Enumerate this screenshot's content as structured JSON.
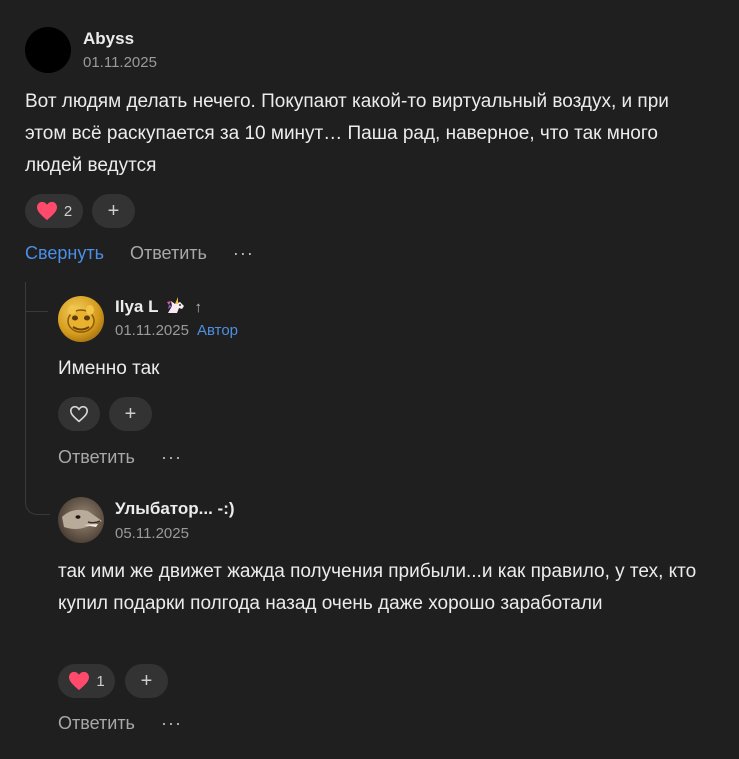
{
  "comments": [
    {
      "author": "Abyss",
      "date": "01.11.2025",
      "text": "Вот людям делать нечего. Покупают какой-то виртуальный воздух, и при этом всё раскупается за 10 минут… Паша рад, наверное, что так много людей ведутся",
      "likes": "2",
      "add": "+",
      "collapse_label": "Свернуть",
      "reply_label": "Ответить",
      "more": "···"
    },
    {
      "author": "Ilya L",
      "date": "01.11.2025",
      "badge": "Автор",
      "author_arrow": "↑",
      "text": "Именно так",
      "add": "+",
      "reply_label": "Ответить",
      "more": "···"
    },
    {
      "author": "Улыбатор... -:)",
      "date": "05.11.2025",
      "text": "так ими же движет жажда получения прибыли...и как правило, у тех, кто купил подарки полгода назад очень даже хорошо заработали",
      "likes": "1",
      "add": "+",
      "reply_label": "Ответить",
      "more": "···"
    }
  ],
  "icons": {
    "heart_filled": "heart-icon",
    "heart_outline": "heart-outline-icon",
    "unicorn": "unicorn-icon",
    "more": "more-icon"
  },
  "colors": {
    "background": "#1f1f1f",
    "accent": "#4a8fe8",
    "heart": "#ff4a6b"
  }
}
